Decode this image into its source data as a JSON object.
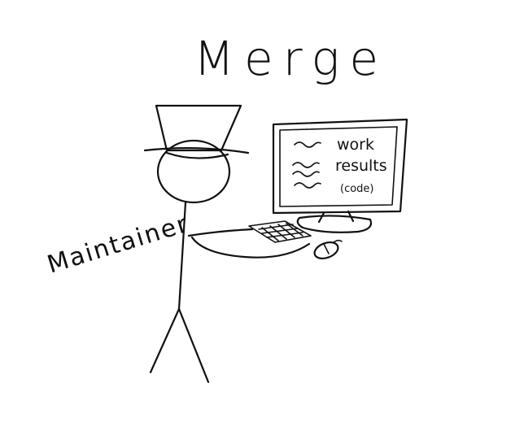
{
  "title": "Merge",
  "role_label": "Maintainer",
  "screen": {
    "line1": "work",
    "line2": "results",
    "line3": "(code)"
  },
  "icons": {
    "figure": "stick-figure-icon",
    "hat": "top-hat-icon",
    "monitor": "monitor-icon",
    "keyboard": "keyboard-icon",
    "mouse": "mouse-icon"
  }
}
